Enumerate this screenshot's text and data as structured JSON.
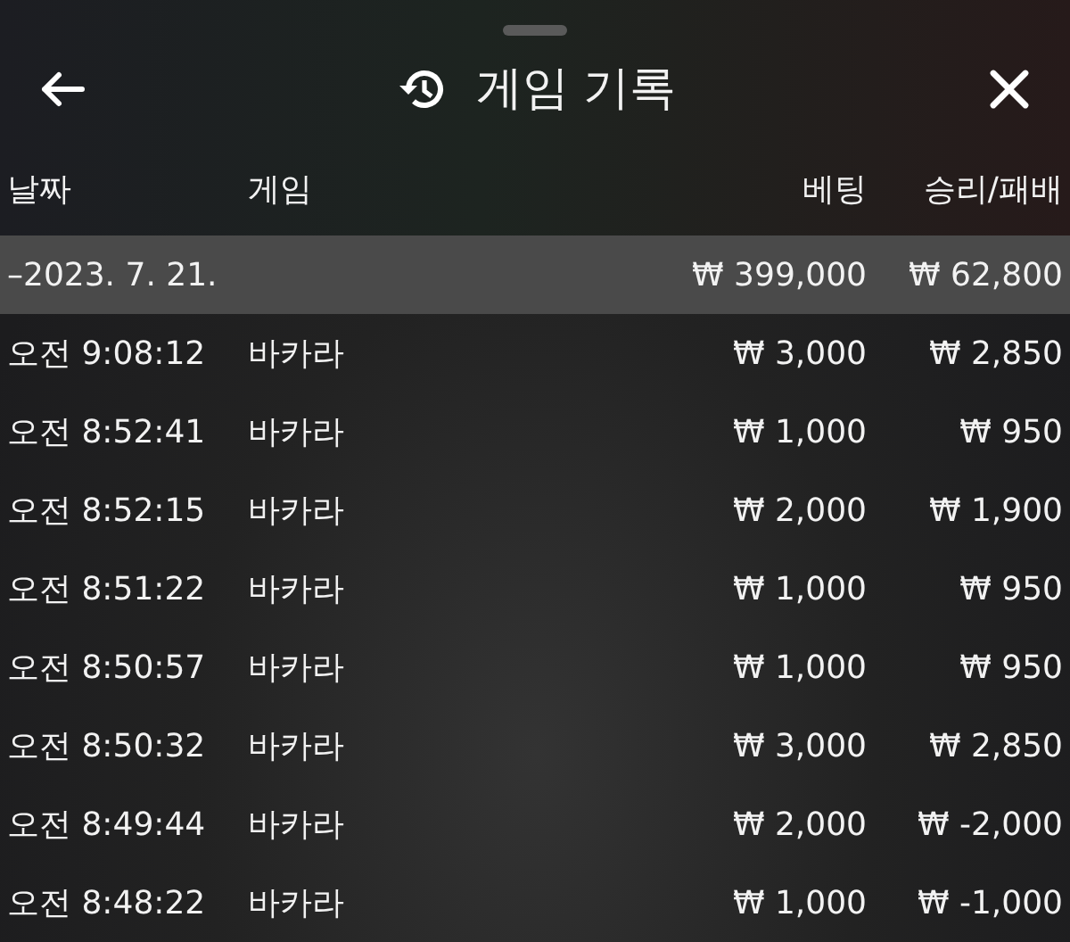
{
  "sheet": {
    "title": "게임 기록"
  },
  "columns": [
    "날짜",
    "게임",
    "베팅",
    "승리/패배"
  ],
  "summary": {
    "date": "–2023. 7. 21.",
    "bet": "₩ 399,000",
    "result": "₩ 62,800"
  },
  "rows": [
    {
      "time": "오전 9:08:12",
      "game": "바카라",
      "bet": "₩ 3,000",
      "result": "₩ 2,850"
    },
    {
      "time": "오전 8:52:41",
      "game": "바카라",
      "bet": "₩ 1,000",
      "result": "₩ 950"
    },
    {
      "time": "오전 8:52:15",
      "game": "바카라",
      "bet": "₩ 2,000",
      "result": "₩ 1,900"
    },
    {
      "time": "오전 8:51:22",
      "game": "바카라",
      "bet": "₩ 1,000",
      "result": "₩ 950"
    },
    {
      "time": "오전 8:50:57",
      "game": "바카라",
      "bet": "₩ 1,000",
      "result": "₩ 950"
    },
    {
      "time": "오전 8:50:32",
      "game": "바카라",
      "bet": "₩ 3,000",
      "result": "₩ 2,850"
    },
    {
      "time": "오전 8:49:44",
      "game": "바카라",
      "bet": "₩ 2,000",
      "result": "₩ -2,000"
    },
    {
      "time": "오전 8:48:22",
      "game": "바카라",
      "bet": "₩ 1,000",
      "result": "₩ -1,000"
    }
  ]
}
